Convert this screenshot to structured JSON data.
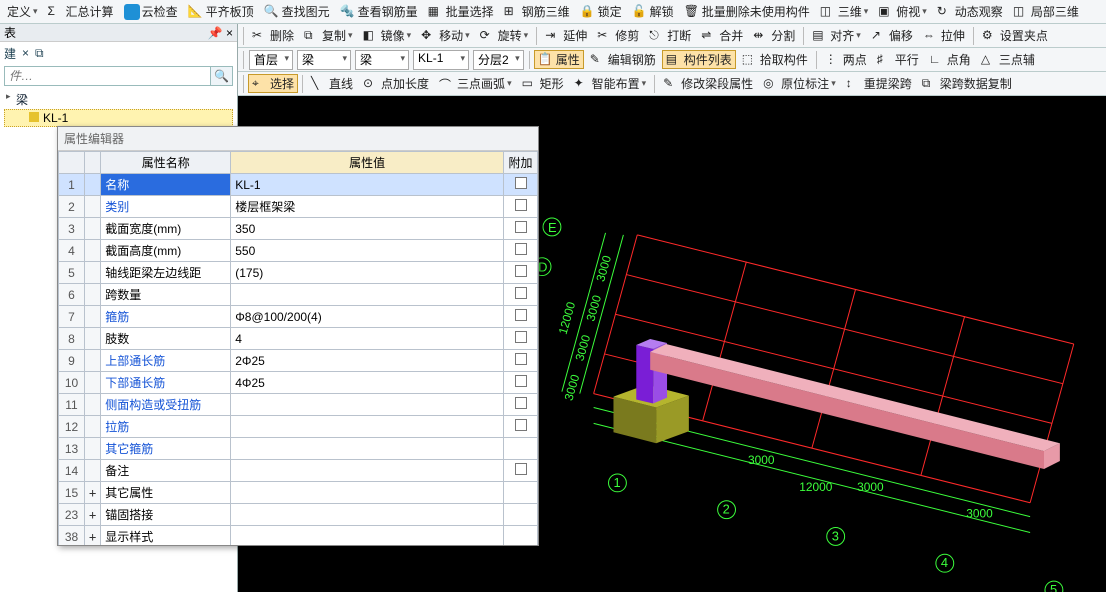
{
  "toolbar1": {
    "define": "定义",
    "sum": "汇总计算",
    "cloud": "云检查",
    "flat": "平齐板顶",
    "find": "查找图元",
    "rebar": "查看钢筋量",
    "batch": "批量选择",
    "rebar3d": "钢筋三维",
    "lock": "锁定",
    "unlock": "解锁",
    "del_unused": "批量删除未使用构件",
    "view3d": "三维",
    "top": "俯视",
    "dyn": "动态观察",
    "local3d": "局部三维"
  },
  "toolbar2": {
    "del": "删除",
    "copy": "复制",
    "mirror": "镜像",
    "move": "移动",
    "rotate": "旋转",
    "extend": "延伸",
    "trim": "修剪",
    "break": "打断",
    "merge": "合并",
    "split": "分割",
    "align": "对齐",
    "offset": "偏移",
    "stretch": "拉伸",
    "setgrip": "设置夹点"
  },
  "toolbar3": {
    "floor": "首层",
    "cat": "梁",
    "type": "梁",
    "inst": "KL-1",
    "layer": "分层2",
    "attrs": "属性",
    "editrebar": "编辑钢筋",
    "list": "构件列表",
    "pick": "拾取构件",
    "two": "两点",
    "parallel": "平行",
    "corner": "点角",
    "three": "三点辅"
  },
  "toolbar4": {
    "select": "选择",
    "line": "直线",
    "addlen": "点加长度",
    "arc3": "三点画弧",
    "rect": "矩形",
    "auto": "智能布置",
    "editspan": "修改梁段属性",
    "origmark": "原位标注",
    "relift": "重提梁跨",
    "copyspan": "梁跨数据复制"
  },
  "left": {
    "title": "表",
    "new": "建",
    "search_ph": "件…",
    "root": "梁",
    "leaf": "KL-1"
  },
  "propwin": {
    "title": "属性编辑器",
    "col_name": "属性名称",
    "col_val": "属性值",
    "col_extra": "附加",
    "rows": [
      {
        "n": "1",
        "name": "名称",
        "val": "KL-1",
        "link": true,
        "sel": true,
        "chk": true
      },
      {
        "n": "2",
        "name": "类别",
        "val": "楼层框架梁",
        "link": true,
        "chk": true
      },
      {
        "n": "3",
        "name": "截面宽度(mm)",
        "val": "350",
        "chk": true
      },
      {
        "n": "4",
        "name": "截面高度(mm)",
        "val": "550",
        "chk": true
      },
      {
        "n": "5",
        "name": "轴线距梁左边线距",
        "val": "(175)",
        "chk": true
      },
      {
        "n": "6",
        "name": "跨数量",
        "val": "",
        "chk": true
      },
      {
        "n": "7",
        "name": "箍筋",
        "val": "Φ8@100/200(4)",
        "link": true,
        "chk": true
      },
      {
        "n": "8",
        "name": "肢数",
        "val": "4",
        "chk": true
      },
      {
        "n": "9",
        "name": "上部通长筋",
        "val": "2Φ25",
        "link": true,
        "chk": true
      },
      {
        "n": "10",
        "name": "下部通长筋",
        "val": "4Φ25",
        "link": true,
        "chk": true
      },
      {
        "n": "11",
        "name": "侧面构造或受扭筋",
        "val": "",
        "link": true,
        "chk": true
      },
      {
        "n": "12",
        "name": "拉筋",
        "val": "",
        "link": true,
        "chk": true
      },
      {
        "n": "13",
        "name": "其它箍筋",
        "val": "",
        "link": true
      },
      {
        "n": "14",
        "name": "备注",
        "val": "",
        "chk": true
      },
      {
        "n": "15",
        "name": "其它属性",
        "val": "",
        "exp": "+"
      },
      {
        "n": "23",
        "name": "锚固搭接",
        "val": "",
        "exp": "+"
      },
      {
        "n": "38",
        "name": "显示样式",
        "val": "",
        "exp": "+"
      }
    ]
  },
  "viewport": {
    "axes_h": [
      "1",
      "2",
      "3",
      "4",
      "5"
    ],
    "axes_v": [
      "E",
      "D"
    ],
    "dim_h": "3000",
    "dim_h_total": "12000",
    "dim_v": "3000",
    "dim_v_total": "12000"
  }
}
